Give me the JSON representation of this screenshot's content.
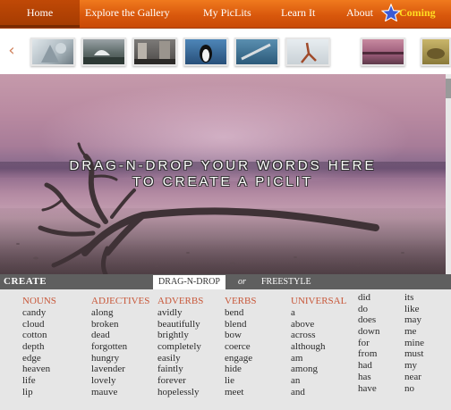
{
  "nav": {
    "items": [
      {
        "label": "Home"
      },
      {
        "label": "Explore the Gallery"
      },
      {
        "label": "My PicLits"
      },
      {
        "label": "Learn It"
      },
      {
        "label": "About"
      }
    ],
    "coming_label": "Coming"
  },
  "colors": {
    "nav_orange": "#d9580c",
    "heading_red": "#c8583a",
    "bar_gray": "#5f5f5f",
    "word_bg": "#e6e6e6"
  },
  "gallery": {
    "thumbnails": [
      {
        "name": "thumb-snow-tree"
      },
      {
        "name": "thumb-mountain-hut"
      },
      {
        "name": "thumb-city-street"
      },
      {
        "name": "thumb-penguin"
      },
      {
        "name": "thumb-diver"
      },
      {
        "name": "thumb-dancer"
      },
      {
        "name": "thumb-pink-sky"
      },
      {
        "name": "thumb-turtle"
      }
    ]
  },
  "hero": {
    "line1": "DRAG-N-DROP YOUR WORDS HERE",
    "line2": "TO CREATE A PICLIT"
  },
  "create_bar": {
    "label": "CREATE",
    "tab_drag": "DRAG-N-DROP",
    "or": "or",
    "tab_free": "FREESTYLE"
  },
  "word_bank": {
    "columns": [
      {
        "heading": "NOUNS",
        "words": [
          "candy",
          "cloud",
          "cotton",
          "depth",
          "edge",
          "heaven",
          "life",
          "lip"
        ]
      },
      {
        "heading": "ADJECTIVES",
        "words": [
          "along",
          "broken",
          "dead",
          "forgotten",
          "hungry",
          "lavender",
          "lovely",
          "mauve"
        ]
      },
      {
        "heading": "ADVERBS",
        "words": [
          "avidly",
          "beautifully",
          "brightly",
          "completely",
          "easily",
          "faintly",
          "forever",
          "hopelessly"
        ]
      },
      {
        "heading": "VERBS",
        "words": [
          "bend",
          "blend",
          "bow",
          "coerce",
          "engage",
          "hide",
          "lie",
          "meet"
        ]
      },
      {
        "heading": "UNIVERSAL",
        "words": [
          "a",
          "above",
          "across",
          "although",
          "am",
          "among",
          "an",
          "and"
        ]
      },
      {
        "heading": "",
        "words": [
          "did",
          "do",
          "does",
          "down",
          "for",
          "from",
          "had",
          "has",
          "have"
        ]
      },
      {
        "heading": "",
        "words": [
          "its",
          "like",
          "may",
          "me",
          "mine",
          "must",
          "my",
          "near",
          "no"
        ]
      }
    ]
  }
}
